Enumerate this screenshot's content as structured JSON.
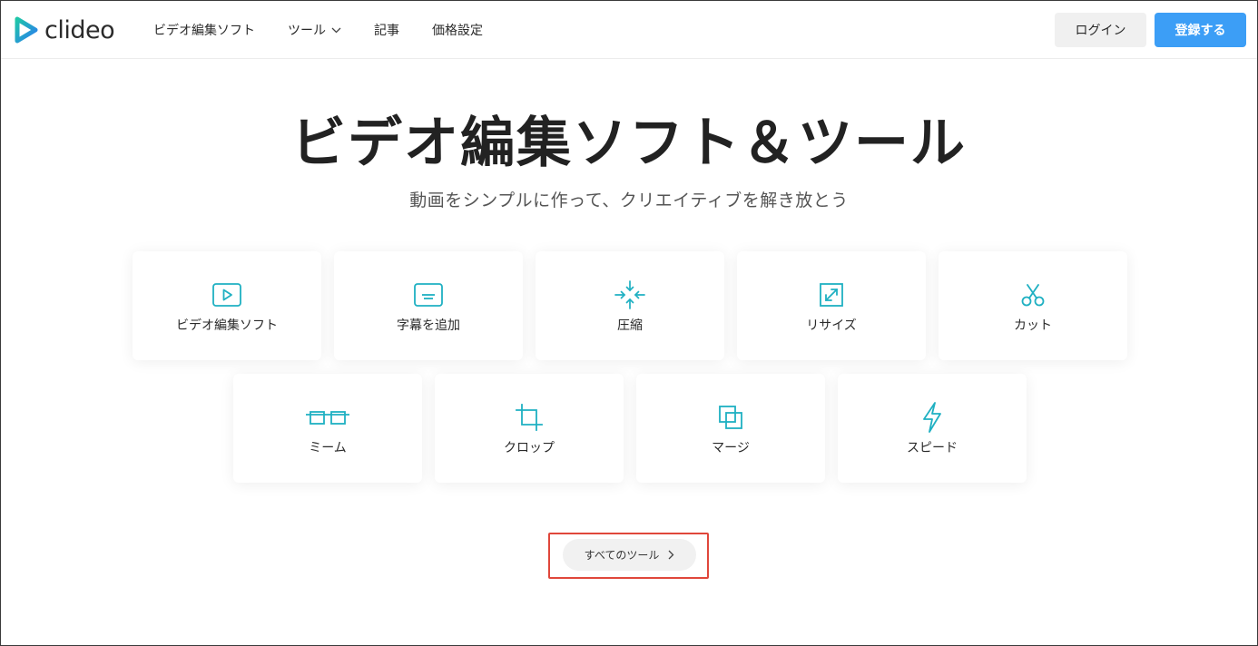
{
  "brand": {
    "name": "clideo",
    "accent": "#3c9ef6",
    "logo_colors": [
      "#1fa8c9",
      "#2a7df0"
    ]
  },
  "nav": {
    "items": [
      {
        "label": "ビデオ編集ソフト"
      },
      {
        "label": "ツール",
        "has_dropdown": true
      },
      {
        "label": "記事"
      },
      {
        "label": "価格設定"
      }
    ]
  },
  "auth": {
    "login_label": "ログイン",
    "signup_label": "登録する"
  },
  "hero": {
    "title": "ビデオ編集ソフト＆ツール",
    "subtitle": "動画をシンプルに作って、クリエイティブを解き放とう"
  },
  "tools": [
    {
      "label": "ビデオ編集ソフト",
      "icon": "play-icon"
    },
    {
      "label": "字幕を追加",
      "icon": "subtitles-icon"
    },
    {
      "label": "圧縮",
      "icon": "compress-icon"
    },
    {
      "label": "リサイズ",
      "icon": "resize-icon"
    },
    {
      "label": "カット",
      "icon": "scissors-icon"
    },
    {
      "label": "ミーム",
      "icon": "glasses-icon"
    },
    {
      "label": "クロップ",
      "icon": "crop-icon"
    },
    {
      "label": "マージ",
      "icon": "merge-icon"
    },
    {
      "label": "スピード",
      "icon": "lightning-icon"
    }
  ],
  "all_tools": {
    "label": "すべてのツール"
  },
  "icon_color": "#1fb0c2"
}
